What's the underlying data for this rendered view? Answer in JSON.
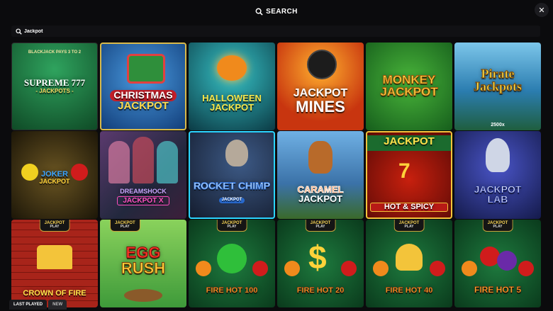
{
  "header": {
    "title": "SEARCH",
    "close_icon": "close-icon",
    "search_icon": "search-icon"
  },
  "search": {
    "value": "Jackpot"
  },
  "games": [
    {
      "title": "SUPREME 777",
      "subtitle": "- JACKPOTS -",
      "topline": "BLACKJACK PAYS 3 TO 2",
      "bg": "#1f7a42"
    },
    {
      "title": "CHRISTMAS",
      "subtitle": "JACKPOT",
      "bg": "#1d5fb3"
    },
    {
      "title": "HALLOWEEN",
      "subtitle": "JACKPOT",
      "bg": "#1e7e8a"
    },
    {
      "title": "JACKPOT",
      "subtitle": "MINES",
      "bg": "#d14b12"
    },
    {
      "title": "MONKEY",
      "subtitle": "JACKPOT",
      "bg": "#1f7d29"
    },
    {
      "title": "Pirate",
      "subtitle": "Jackpots",
      "extra": "2500x",
      "bg": "#2f86b7"
    },
    {
      "title": "JOKER",
      "subtitle": "JACKPOT",
      "bg": "#3a2c0f"
    },
    {
      "title": "DREAMSHOCK",
      "subtitle": "JACKPOT X",
      "bg": "#3b2a4a"
    },
    {
      "title": "ROCKET CHIMP",
      "subtitle": "JACKPOT",
      "bg": "#2c3a55"
    },
    {
      "title": "CARAMEL",
      "subtitle": "JACKPOT",
      "bg": "#3b72a8"
    },
    {
      "title": "JACKPOT",
      "subtitle": "HOT & SPICY",
      "bg": "#1b6b2e"
    },
    {
      "title": "JACKPOT",
      "subtitle": "LAB",
      "bg": "#2a2f86"
    },
    {
      "title": "CROWN OF FIRE",
      "badge": "JACKPOT",
      "badge_sub": "PLAY",
      "bg": "#b3271c"
    },
    {
      "title": "EGG",
      "subtitle": "RUSH",
      "badge": "JACKPOT",
      "badge_sub": "PLAY",
      "bg": "#5dbf47"
    },
    {
      "title": "FIRE HOT 100",
      "badge": "JACKPOT",
      "badge_sub": "PLAY",
      "bg": "#0f5a2e"
    },
    {
      "title": "FIRE HOT 20",
      "badge": "JACKPOT",
      "badge_sub": "PLAY",
      "bg": "#0f5a2e"
    },
    {
      "title": "FIRE HOT 40",
      "badge": "JACKPOT",
      "badge_sub": "PLAY",
      "bg": "#0f5a2e"
    },
    {
      "title": "FIRE HOT 5",
      "badge": "JACKPOT",
      "badge_sub": "PLAY",
      "bg": "#0f5a2e"
    }
  ],
  "tabs": {
    "last_played": "LAST PLAYED",
    "new": "NEW"
  }
}
